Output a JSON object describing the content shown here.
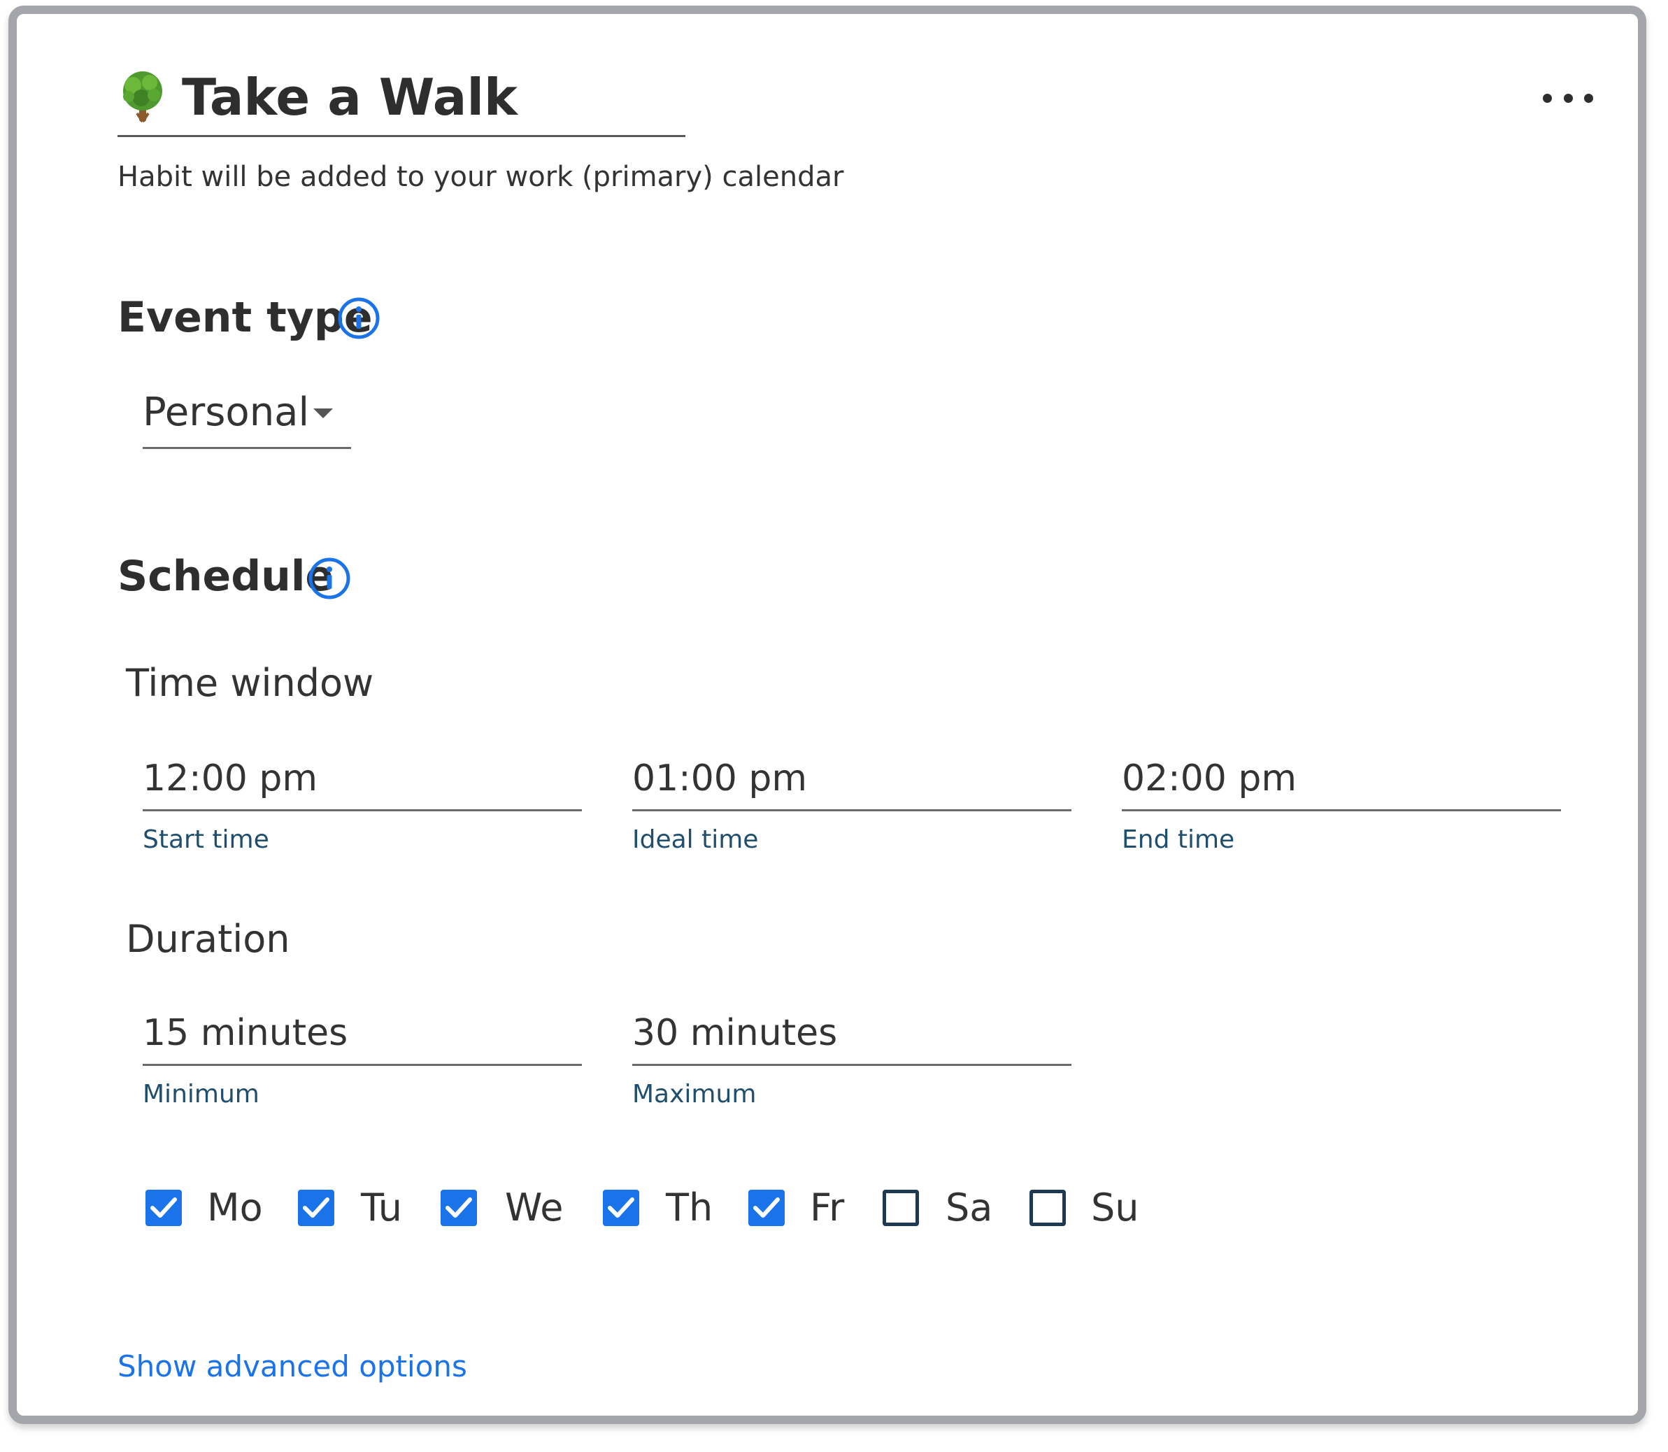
{
  "header": {
    "title": "Take a Walk",
    "icon": "tree-icon",
    "subtitle": "Habit will be added to your work (primary) calendar",
    "menu_icon": "more-horizontal-icon"
  },
  "event_type": {
    "heading": "Event type",
    "info_icon": "info-icon",
    "selected": "Personal"
  },
  "schedule": {
    "heading": "Schedule",
    "info_icon": "info-icon",
    "time_window": {
      "label": "Time window",
      "start": {
        "value": "12:00 pm",
        "helper": "Start time"
      },
      "ideal": {
        "value": "01:00 pm",
        "helper": "Ideal time"
      },
      "end": {
        "value": "02:00 pm",
        "helper": "End time"
      }
    },
    "duration": {
      "label": "Duration",
      "min": {
        "value": "15 minutes",
        "helper": "Minimum"
      },
      "max": {
        "value": "30 minutes",
        "helper": "Maximum"
      }
    },
    "days": [
      {
        "label": "Mo",
        "checked": true
      },
      {
        "label": "Tu",
        "checked": true
      },
      {
        "label": "We",
        "checked": true
      },
      {
        "label": "Th",
        "checked": true
      },
      {
        "label": "Fr",
        "checked": true
      },
      {
        "label": "Sa",
        "checked": false
      },
      {
        "label": "Su",
        "checked": false
      }
    ]
  },
  "advanced_link": "Show advanced options",
  "colors": {
    "accent": "#1a73e8",
    "helper_text": "#1f4e6e",
    "text": "#333333",
    "frame": "#a5a6ab"
  }
}
